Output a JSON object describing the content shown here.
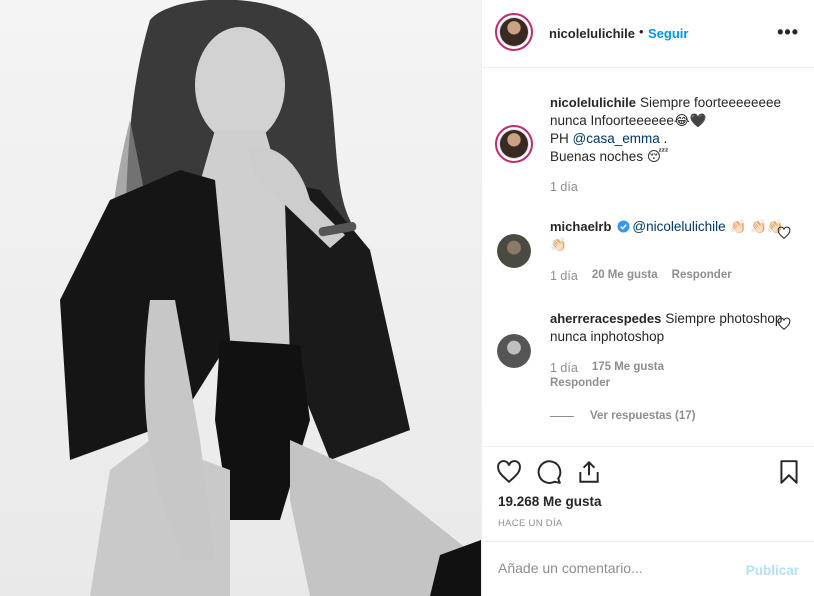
{
  "post": {
    "author": "nicolelulichile",
    "follow_label": "Seguir",
    "separator": "•",
    "more_label": "•••"
  },
  "caption": {
    "username": "nicolelulichile",
    "line1": "Siempre foorteeeeeeee nunca Infoorteeeeee😂🖤",
    "line2_prefix": "PH ",
    "line2_mention": "@casa_emma",
    "line2_suffix": " .",
    "line3": "Buenas noches 😴",
    "time": "1 día"
  },
  "comments": [
    {
      "username": "michaelrb",
      "mention": "@nicolelulichile",
      "text": "👏🏻 👏🏻👏🏻👏🏻",
      "time": "1 día",
      "likes": "20 Me gusta",
      "reply_label": "Responder"
    },
    {
      "username": "aherreracespedes",
      "text": "Siempre photoshop nunca inphotoshop",
      "time": "1 día",
      "likes": "175 Me gusta",
      "reply_label": "Responder"
    }
  ],
  "view_replies": "Ver respuestas (17)",
  "likes_count": "19.268 Me gusta",
  "posted_ago": "HACE UN DÍA",
  "add_comment": {
    "placeholder": "Añade un comentario...",
    "publish_label": "Publicar"
  },
  "colors": {
    "accent": "#0095f6",
    "publish_disabled": "#b2dffc",
    "muted": "#8e8e8e",
    "border": "#efefef"
  },
  "icons": [
    "more-options-icon",
    "heart-icon",
    "comment-icon",
    "share-icon",
    "bookmark-icon",
    "verified-badge-icon",
    "like-comment-icon"
  ]
}
